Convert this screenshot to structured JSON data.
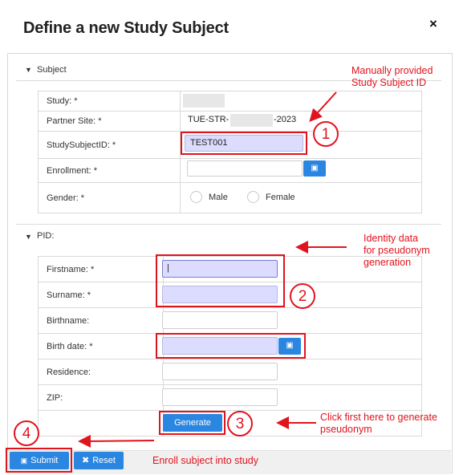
{
  "dialog": {
    "title": "Define a new Study Subject",
    "close_label": "×"
  },
  "subject": {
    "section_label": "Subject",
    "study_label": "Study: *",
    "partner_site_label": "Partner Site: *",
    "partner_site_value_start": "TUE-STR-",
    "partner_site_value_end": "-2023",
    "subject_id_label": "StudySubjectID: *",
    "subject_id_value": "TEST001",
    "enrollment_label": "Enrollment: *",
    "gender_label": "Gender: *",
    "gender_options": [
      "Male",
      "Female"
    ]
  },
  "pid": {
    "section_label": "PID:",
    "fields": [
      {
        "label": "Firstname: *",
        "value": "|"
      },
      {
        "label": "Surname: *",
        "value": ""
      },
      {
        "label": "Birthname:",
        "value": ""
      },
      {
        "label": "Birth date: *",
        "value": ""
      },
      {
        "label": "Residence:",
        "value": ""
      },
      {
        "label": "ZIP:",
        "value": ""
      }
    ],
    "generate_label": "Generate"
  },
  "footer": {
    "submit_label": "Submit",
    "reset_label": "Reset"
  },
  "annotations": {
    "notes": [
      "Manually provided\nStudy Subject ID",
      "Identity data\nfor pseudonym\ngeneration",
      "Click first here to generate\npseudonym",
      "Enroll subject into study"
    ],
    "numbers": [
      "1",
      "2",
      "3",
      "4"
    ],
    "color": "#e0141e"
  },
  "colors": {
    "accent": "#2a86e0",
    "highlight_input": "#dcdcff",
    "annotation": "#e0141e"
  }
}
